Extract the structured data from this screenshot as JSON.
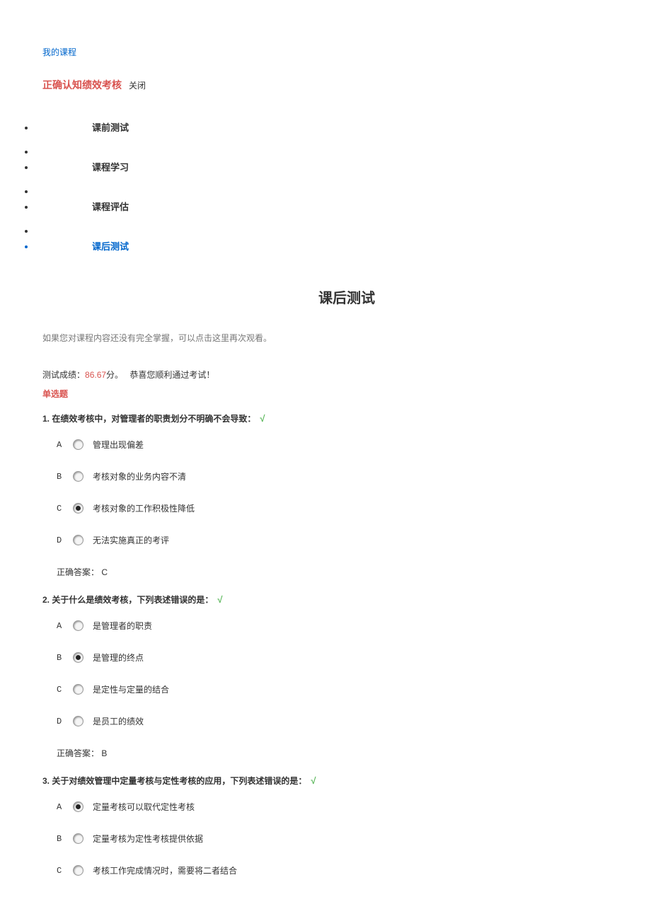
{
  "header": {
    "myCourse": "我的课程",
    "courseTitle": "正确认知绩效考核",
    "close": "关闭"
  },
  "nav": [
    {
      "id": "pre",
      "label": "课前测试",
      "active": false
    },
    {
      "id": "study",
      "label": "课程学习",
      "active": false
    },
    {
      "id": "eval",
      "label": "课程评估",
      "active": false
    },
    {
      "id": "post",
      "label": "课后测试",
      "active": true
    }
  ],
  "sectionTitle": "课后测试",
  "hint": "如果您对课程内容还没有完全掌握，可以点击这里再次观看。",
  "score": {
    "label": "测试成绩：",
    "value": "86.67",
    "unit": "分。",
    "congrats": " 恭喜您顺利通过考试！"
  },
  "qtype": "单选题",
  "questions": [
    {
      "num": "1.",
      "stem": "在绩效考核中，对管理者的职责划分不明确不会导致：",
      "correct": true,
      "opts": [
        {
          "l": "A",
          "t": "管理出现偏差",
          "sel": false
        },
        {
          "l": "B",
          "t": "考核对象的业务内容不清",
          "sel": false
        },
        {
          "l": "C",
          "t": "考核对象的工作积极性降低",
          "sel": true
        },
        {
          "l": "D",
          "t": "无法实施真正的考评",
          "sel": false
        }
      ],
      "ans": "正确答案： C"
    },
    {
      "num": "2.",
      "stem": "关于什么是绩效考核，下列表述错误的是：",
      "correct": true,
      "opts": [
        {
          "l": "A",
          "t": "是管理者的职责",
          "sel": false
        },
        {
          "l": "B",
          "t": "是管理的终点",
          "sel": true
        },
        {
          "l": "C",
          "t": "是定性与定量的结合",
          "sel": false
        },
        {
          "l": "D",
          "t": "是员工的绩效",
          "sel": false
        }
      ],
      "ans": "正确答案： B"
    },
    {
      "num": "3.",
      "stem": "关于对绩效管理中定量考核与定性考核的应用，下列表述错误的是：",
      "correct": true,
      "opts": [
        {
          "l": "A",
          "t": "定量考核可以取代定性考核",
          "sel": true
        },
        {
          "l": "B",
          "t": "定量考核为定性考核提供依据",
          "sel": false
        },
        {
          "l": "C",
          "t": "考核工作完成情况时，需要将二者结合",
          "sel": false
        }
      ],
      "ans": null
    }
  ]
}
